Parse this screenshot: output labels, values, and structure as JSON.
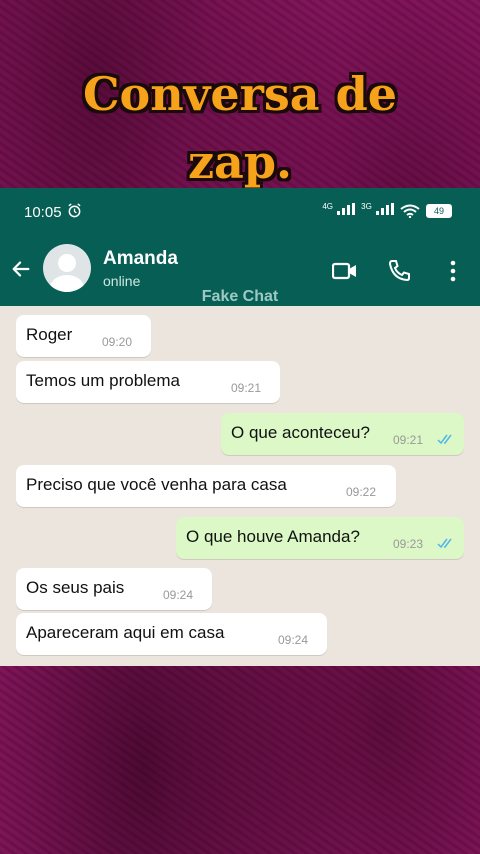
{
  "overlay": {
    "title_line1": "Conversa de",
    "title_line2": "zap."
  },
  "statusbar": {
    "time": "10:05",
    "net1": "4G",
    "net2": "3G",
    "battery": "49"
  },
  "header": {
    "contact_name": "Amanda",
    "contact_status": "online",
    "watermark": "Fake Chat"
  },
  "colors": {
    "header_green": "#075e54",
    "outgoing_bubble": "#dcf8c6",
    "chat_background": "#ece5dd",
    "title_orange": "#f7a21b",
    "read_ticks": "#4fb6ec"
  },
  "messages": [
    {
      "direction": "in",
      "text": "Roger",
      "time": "09:20"
    },
    {
      "direction": "in",
      "text": "Temos um problema",
      "time": "09:21"
    },
    {
      "direction": "out",
      "text": "O que aconteceu?",
      "time": "09:21",
      "status": "read"
    },
    {
      "direction": "in",
      "text": "Preciso que você venha para casa",
      "time": "09:22"
    },
    {
      "direction": "out",
      "text": "O que houve Amanda?",
      "time": "09:23",
      "status": "read"
    },
    {
      "direction": "in",
      "text": "Os seus pais",
      "time": "09:24"
    },
    {
      "direction": "in",
      "text": "Apareceram aqui em casa",
      "time": "09:24"
    }
  ]
}
